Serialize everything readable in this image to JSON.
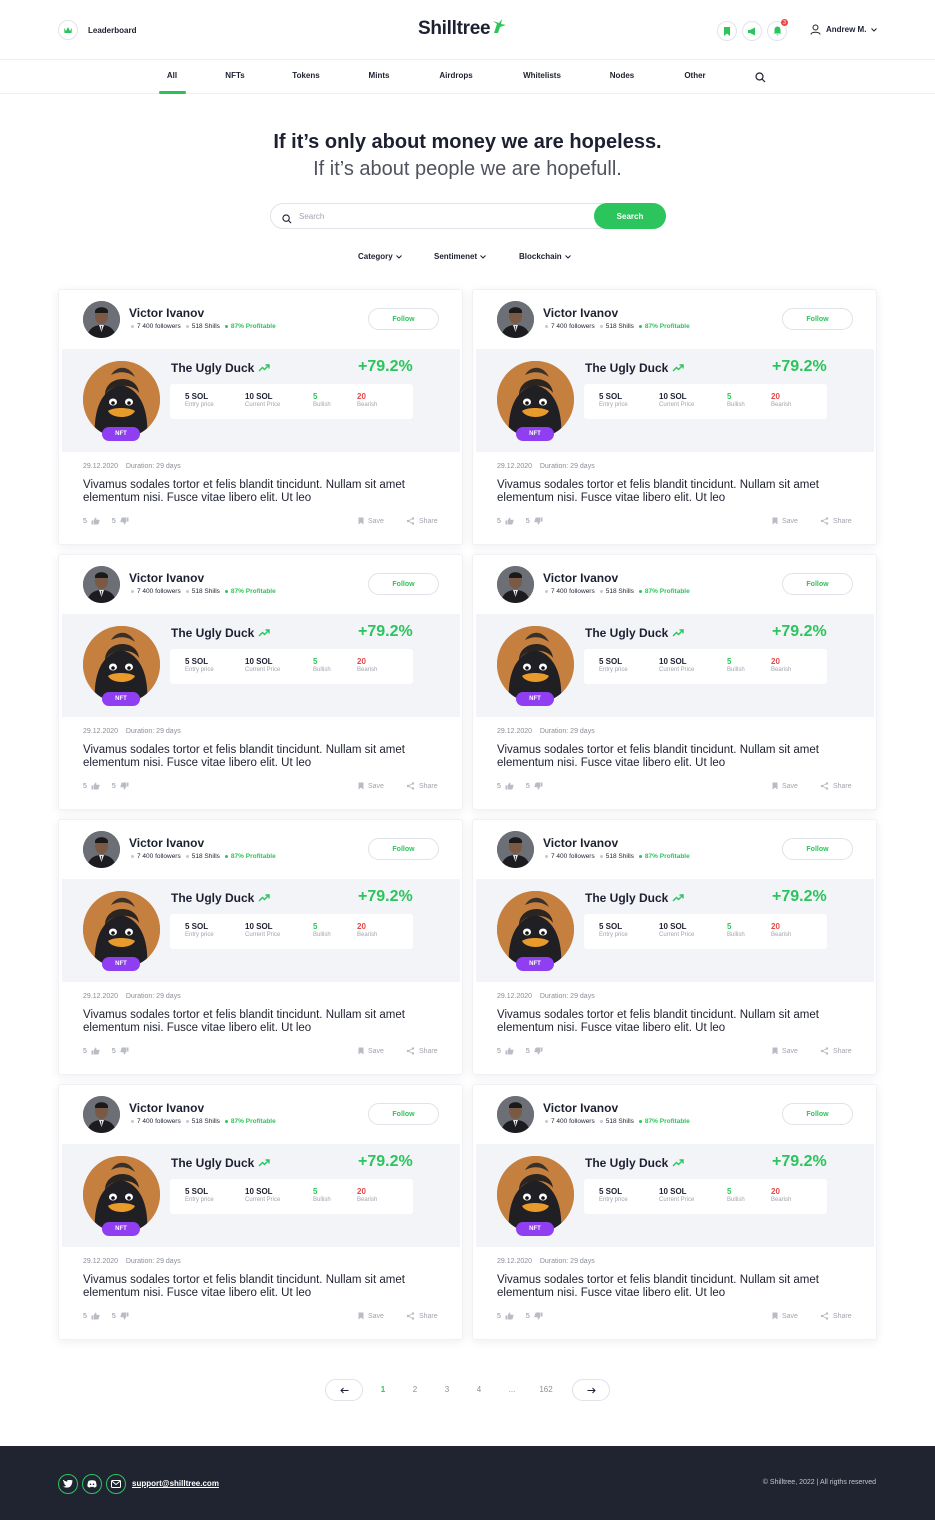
{
  "header": {
    "leaderboard_label": "Leaderboard",
    "logo_text": "Shilltree",
    "notification_count": "3",
    "user_name": "Andrew M."
  },
  "nav": {
    "tabs": [
      "All",
      "NFTs",
      "Tokens",
      "Mints",
      "Airdrops",
      "Whitelists",
      "Nodes",
      "Other"
    ],
    "active_tab": "All"
  },
  "hero": {
    "line1": "If it’s only about money we are hopeless.",
    "line2": "If it’s about people we are hopefull."
  },
  "search": {
    "placeholder": "Search",
    "button_label": "Search"
  },
  "filters": [
    "Category",
    "Sentimenet",
    "Blockchain"
  ],
  "card": {
    "author_name": "Victor Ivanov",
    "followers": "7 400 followers",
    "shills": "518 Shills",
    "profitable": "87% Profitable",
    "follow_label": "Follow",
    "nft_name": "The Ugly Duck",
    "change": "+79.2%",
    "tag": "NFT",
    "entry_price": "5 SOL",
    "entry_price_label": "Entry price",
    "current_price": "10 SOL",
    "current_price_label": "Current Price",
    "bullish": "5",
    "bullish_label": "Bullish",
    "bearish": "20",
    "bearish_label": "Bearish",
    "date": "29.12.2020",
    "duration": "Duration: 29 days",
    "description": "Vivamus sodales tortor et felis blandit tincidunt. Nullam sit amet elementum nisi. Fusce vitae libero elit. Ut leo",
    "likes": "5",
    "dislikes": "5",
    "save_label": "Save",
    "share_label": "Share"
  },
  "pagination": {
    "pages": [
      "1",
      "2",
      "3",
      "4",
      "...",
      "162"
    ],
    "current": "1"
  },
  "footer": {
    "email": "support@shilltree.com",
    "copyright": "© Shilltree, 2022 | All rigths reserved"
  },
  "colors": {
    "accent": "#2cc45c",
    "negative": "#e84848",
    "tag": "#8f3ef2",
    "footer_bg": "#1f2430"
  }
}
